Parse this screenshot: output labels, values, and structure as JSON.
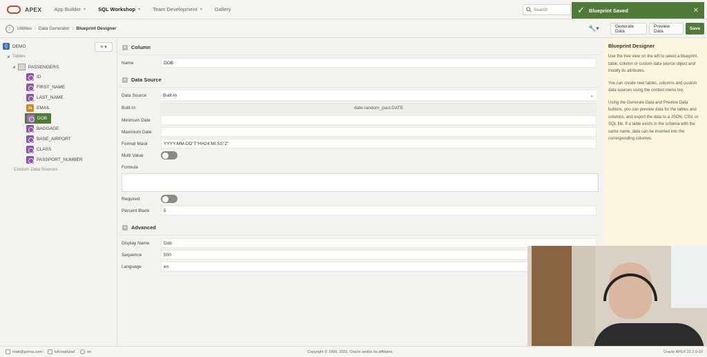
{
  "header": {
    "brand": "APEX",
    "nav": [
      {
        "label": "App Builder"
      },
      {
        "label": "SQL Workshop",
        "active": true
      },
      {
        "label": "Team Development"
      },
      {
        "label": "Gallery"
      }
    ],
    "search_placeholder": "Search"
  },
  "toast": {
    "message": "Blueprint Saved"
  },
  "breadcrumb": {
    "items": [
      "Utilities",
      "Data Generator",
      "Blueprint Designer"
    ]
  },
  "toolbar": {
    "generate": "Generate Data",
    "preview": "Preview Data",
    "save": "Save"
  },
  "tree": {
    "root": "DEMO",
    "tables_label": "Tables",
    "table": "PASSENGERS",
    "columns": [
      {
        "name": "ID",
        "icon": "column-icon"
      },
      {
        "name": "FIRST_NAME",
        "icon": "column-icon"
      },
      {
        "name": "LAST_NAME",
        "icon": "column-icon"
      },
      {
        "name": "EMAIL",
        "icon": "formula-icon"
      },
      {
        "name": "DOB",
        "icon": "column-icon",
        "selected": true
      },
      {
        "name": "BAGGAGE",
        "icon": "column-icon"
      },
      {
        "name": "BASE_AIRPORT",
        "icon": "column-icon"
      },
      {
        "name": "CLASS",
        "icon": "column-icon"
      },
      {
        "name": "PASSPORT_NUMBER",
        "icon": "column-icon"
      }
    ],
    "custom_sources": "Custom Data Sources"
  },
  "column": {
    "title": "Column",
    "name_label": "Name",
    "name_value": "DOB"
  },
  "data_source": {
    "title": "Data Source",
    "source_label": "Data Source",
    "source_value": "Built-In",
    "builtin_label": "Built-In",
    "builtin_value": "date.random_past.DATE",
    "min_label": "Minimum Date",
    "min_value": "",
    "max_label": "Maximum Date",
    "max_value": "",
    "mask_label": "Format Mask",
    "mask_value": "YYYY-MM-DD\"T\"HH24:MI:SS\"Z\"",
    "multi_label": "Multi Value",
    "formula_label": "Formula",
    "required_label": "Required",
    "blank_label": "Percent Blank",
    "blank_value": "5"
  },
  "advanced": {
    "title": "Advanced",
    "display_label": "Display Name",
    "display_value": "Dob",
    "seq_label": "Sequence",
    "seq_value": "500",
    "lang_label": "Language",
    "lang_value": "en"
  },
  "help": {
    "title": "Blueprint Designer",
    "p1": "Use the tree view on the left to select a blueprint, table, column or custom data source object and modify its attributes.",
    "p2": "You can create new tables, columns and custom data sources using the context menu too.",
    "p3": "Using the Generate Data and Preview Data buttons, you can preview data for the tables and columns, and export the data to a JSON, CSV, or SQL file. If a table exists in the schema with the same name, data can be inserted into the corresponding columns."
  },
  "footer": {
    "user": "matt@gizma.com",
    "workspace": "lufcmattylad",
    "lang": "en",
    "copyright": "Copyright © 1999, 2022, Oracle and/or its affiliates.",
    "version": "Oracle APEX 22.2.0-19"
  }
}
